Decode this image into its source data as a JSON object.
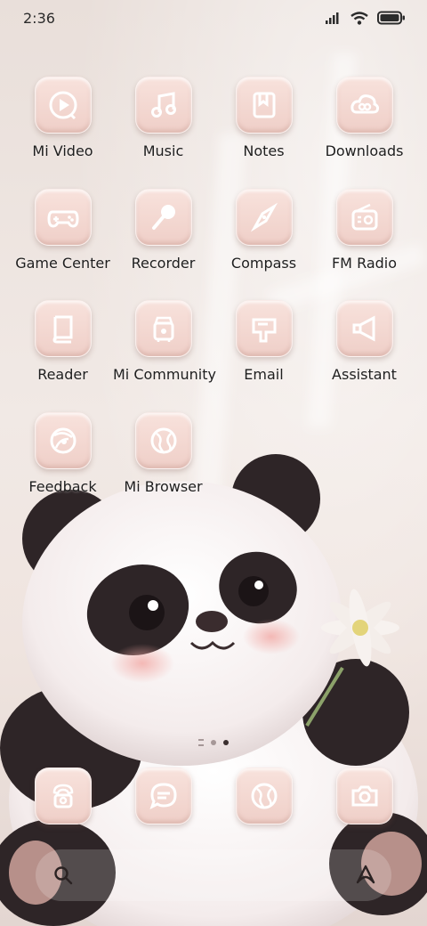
{
  "status_bar": {
    "time": "2:36"
  },
  "apps": [
    {
      "label": "Mi Video",
      "icon": "play-icon"
    },
    {
      "label": "Music",
      "icon": "music-note-icon"
    },
    {
      "label": "Notes",
      "icon": "notes-icon"
    },
    {
      "label": "Downloads",
      "icon": "cloud-download-icon"
    },
    {
      "label": "Game Center",
      "icon": "gamepad-icon"
    },
    {
      "label": "Recorder",
      "icon": "microphone-icon"
    },
    {
      "label": "Compass",
      "icon": "compass-icon"
    },
    {
      "label": "FM Radio",
      "icon": "radio-icon"
    },
    {
      "label": "Reader",
      "icon": "book-icon"
    },
    {
      "label": "Mi Community",
      "icon": "community-icon"
    },
    {
      "label": "Email",
      "icon": "mailbox-icon"
    },
    {
      "label": "Assistant",
      "icon": "megaphone-icon"
    },
    {
      "label": "Feedback",
      "icon": "feedback-icon"
    },
    {
      "label": "Mi Browser",
      "icon": "globe-icon"
    }
  ],
  "dock": [
    {
      "icon": "phone-icon"
    },
    {
      "icon": "messages-icon"
    },
    {
      "icon": "browser-icon"
    },
    {
      "icon": "camera-icon"
    }
  ],
  "page_indicator": {
    "pages": 2,
    "active": 1
  },
  "colors": {
    "icon_bg": "#f3d8d1",
    "label": "#1e1e1e"
  }
}
